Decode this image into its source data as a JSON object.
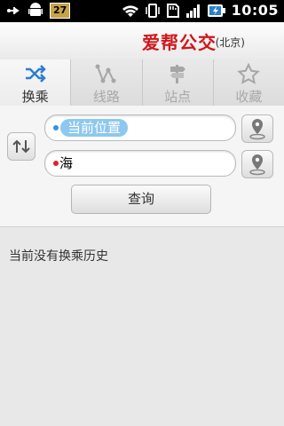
{
  "status_bar": {
    "badge": "27",
    "time": "10:05",
    "icons": [
      "usb-icon",
      "android-icon",
      "wifi-icon",
      "vibrate-icon",
      "sd-card-icon",
      "signal-icon",
      "battery-charging-icon"
    ]
  },
  "header": {
    "title": "爱帮公交",
    "city": "(北京)"
  },
  "tabs": [
    {
      "label": "换乘",
      "icon": "transfer-icon",
      "active": true
    },
    {
      "label": "线路",
      "icon": "route-icon",
      "active": false
    },
    {
      "label": "站点",
      "icon": "stop-sign-icon",
      "active": false
    },
    {
      "label": "收藏",
      "icon": "star-icon",
      "active": false
    }
  ],
  "form": {
    "from_value": "当前位置",
    "to_value": "海",
    "search_label": "查询",
    "from_dot_color": "#3a8ee6",
    "to_dot_color": "#e0202a"
  },
  "history": {
    "empty_text": "当前没有换乘历史"
  },
  "colors": {
    "brand_red": "#d0161b",
    "chip_blue": "#8ec8ee"
  }
}
